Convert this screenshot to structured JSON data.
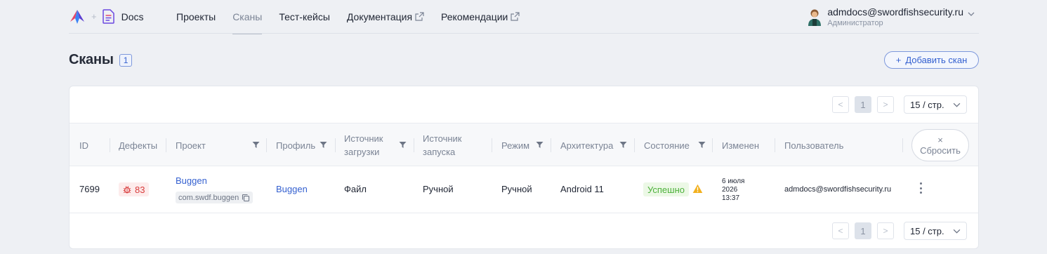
{
  "header": {
    "docs_label": "Docs",
    "plus_sign": "+",
    "nav": [
      {
        "label": "Проекты"
      },
      {
        "label": "Сканы"
      },
      {
        "label": "Тест-кейсы"
      },
      {
        "label": "Документация"
      },
      {
        "label": "Рекомендации"
      }
    ],
    "user": {
      "email": "admdocs@swordfishsecurity.ru",
      "role": "Администратор"
    }
  },
  "page": {
    "title": "Сканы",
    "count": "1",
    "add_button": "Добавить скан",
    "add_button_icon": "+"
  },
  "pagination": {
    "prev": "<",
    "next": ">",
    "current": "1",
    "per_page": "15 / стр."
  },
  "table": {
    "headers": {
      "id": "ID",
      "defects": "Дефекты",
      "project": "Проект",
      "profile": "Профиль",
      "upload_source_line1": "Источник",
      "upload_source_line2": "загрузки",
      "launch_source_line1": "Источник",
      "launch_source_line2": "запуска",
      "mode": "Режим",
      "architecture": "Архитектура",
      "state": "Состояние",
      "modified": "Изменен",
      "user": "Пользователь"
    },
    "reset": {
      "icon": "×",
      "label": "Сбросить"
    },
    "rows": [
      {
        "id": "7699",
        "defects": "83",
        "project": "Buggen",
        "package": "com.swdf.buggen",
        "profile": "Buggen",
        "upload_source": "Файл",
        "launch_source": "Ручной",
        "mode": "Ручной",
        "architecture": "Android 11",
        "state": "Успешно",
        "modified_line1": "6 июля",
        "modified_line2": "2026",
        "modified_line3": "13:37",
        "user": "admdocs@swordfishsecurity.ru"
      }
    ]
  },
  "colors": {
    "accent": "#3561d0",
    "success": "#4cb13a",
    "danger": "#d83b3b",
    "warning": "#f2b01e"
  }
}
